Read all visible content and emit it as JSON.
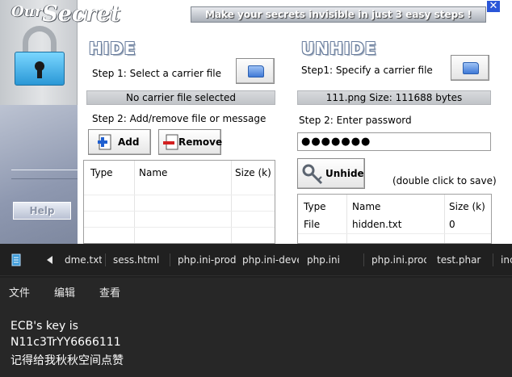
{
  "app": {
    "logo_our": "Our",
    "logo_secret": "Secret",
    "banner": "Make your secrets invisible in just 3 easy steps !",
    "close_glyph": "✕",
    "help_label": "Help",
    "icons": [
      "padlock-icon",
      "folder-icon",
      "add-file-icon",
      "remove-file-icon",
      "keys-icon"
    ],
    "hide": {
      "title": "HIDE",
      "step1": "Step 1: Select a carrier file",
      "carrier_status": "No carrier file selected",
      "step2": "Step 2: Add/remove file or message",
      "add_label": "Add",
      "remove_label": "Remove",
      "columns": [
        "Type",
        "Name",
        "Size (k)"
      ],
      "rows": []
    },
    "unhide": {
      "title": "UNHIDE",
      "step1": "Step1: Specify a carrier file",
      "carrier_info": "111.png   Size: 111688 bytes",
      "step2": "Step 2: Enter password",
      "password_mask": "●●●●●●●",
      "unhide_label": "Unhide",
      "hint": "(double click to save)",
      "columns": [
        "Type",
        "Name",
        "Size (k)"
      ],
      "rows": [
        {
          "type": "File",
          "name": "hidden.txt",
          "size": "0"
        }
      ]
    }
  },
  "notepad": {
    "file_icon": "notepad-file-icon",
    "tabs": [
      "dme.txt",
      "sess.html",
      "php.ini-prod",
      "php.ini-deve",
      "php.ini",
      "php.ini.prod",
      "test.phar",
      "inc"
    ],
    "menu": [
      "文件",
      "编辑",
      "查看"
    ],
    "lines": [
      "ECB's key is",
      "N11c3TrYY6666111",
      "记得给我秋秋空间点赞"
    ]
  }
}
